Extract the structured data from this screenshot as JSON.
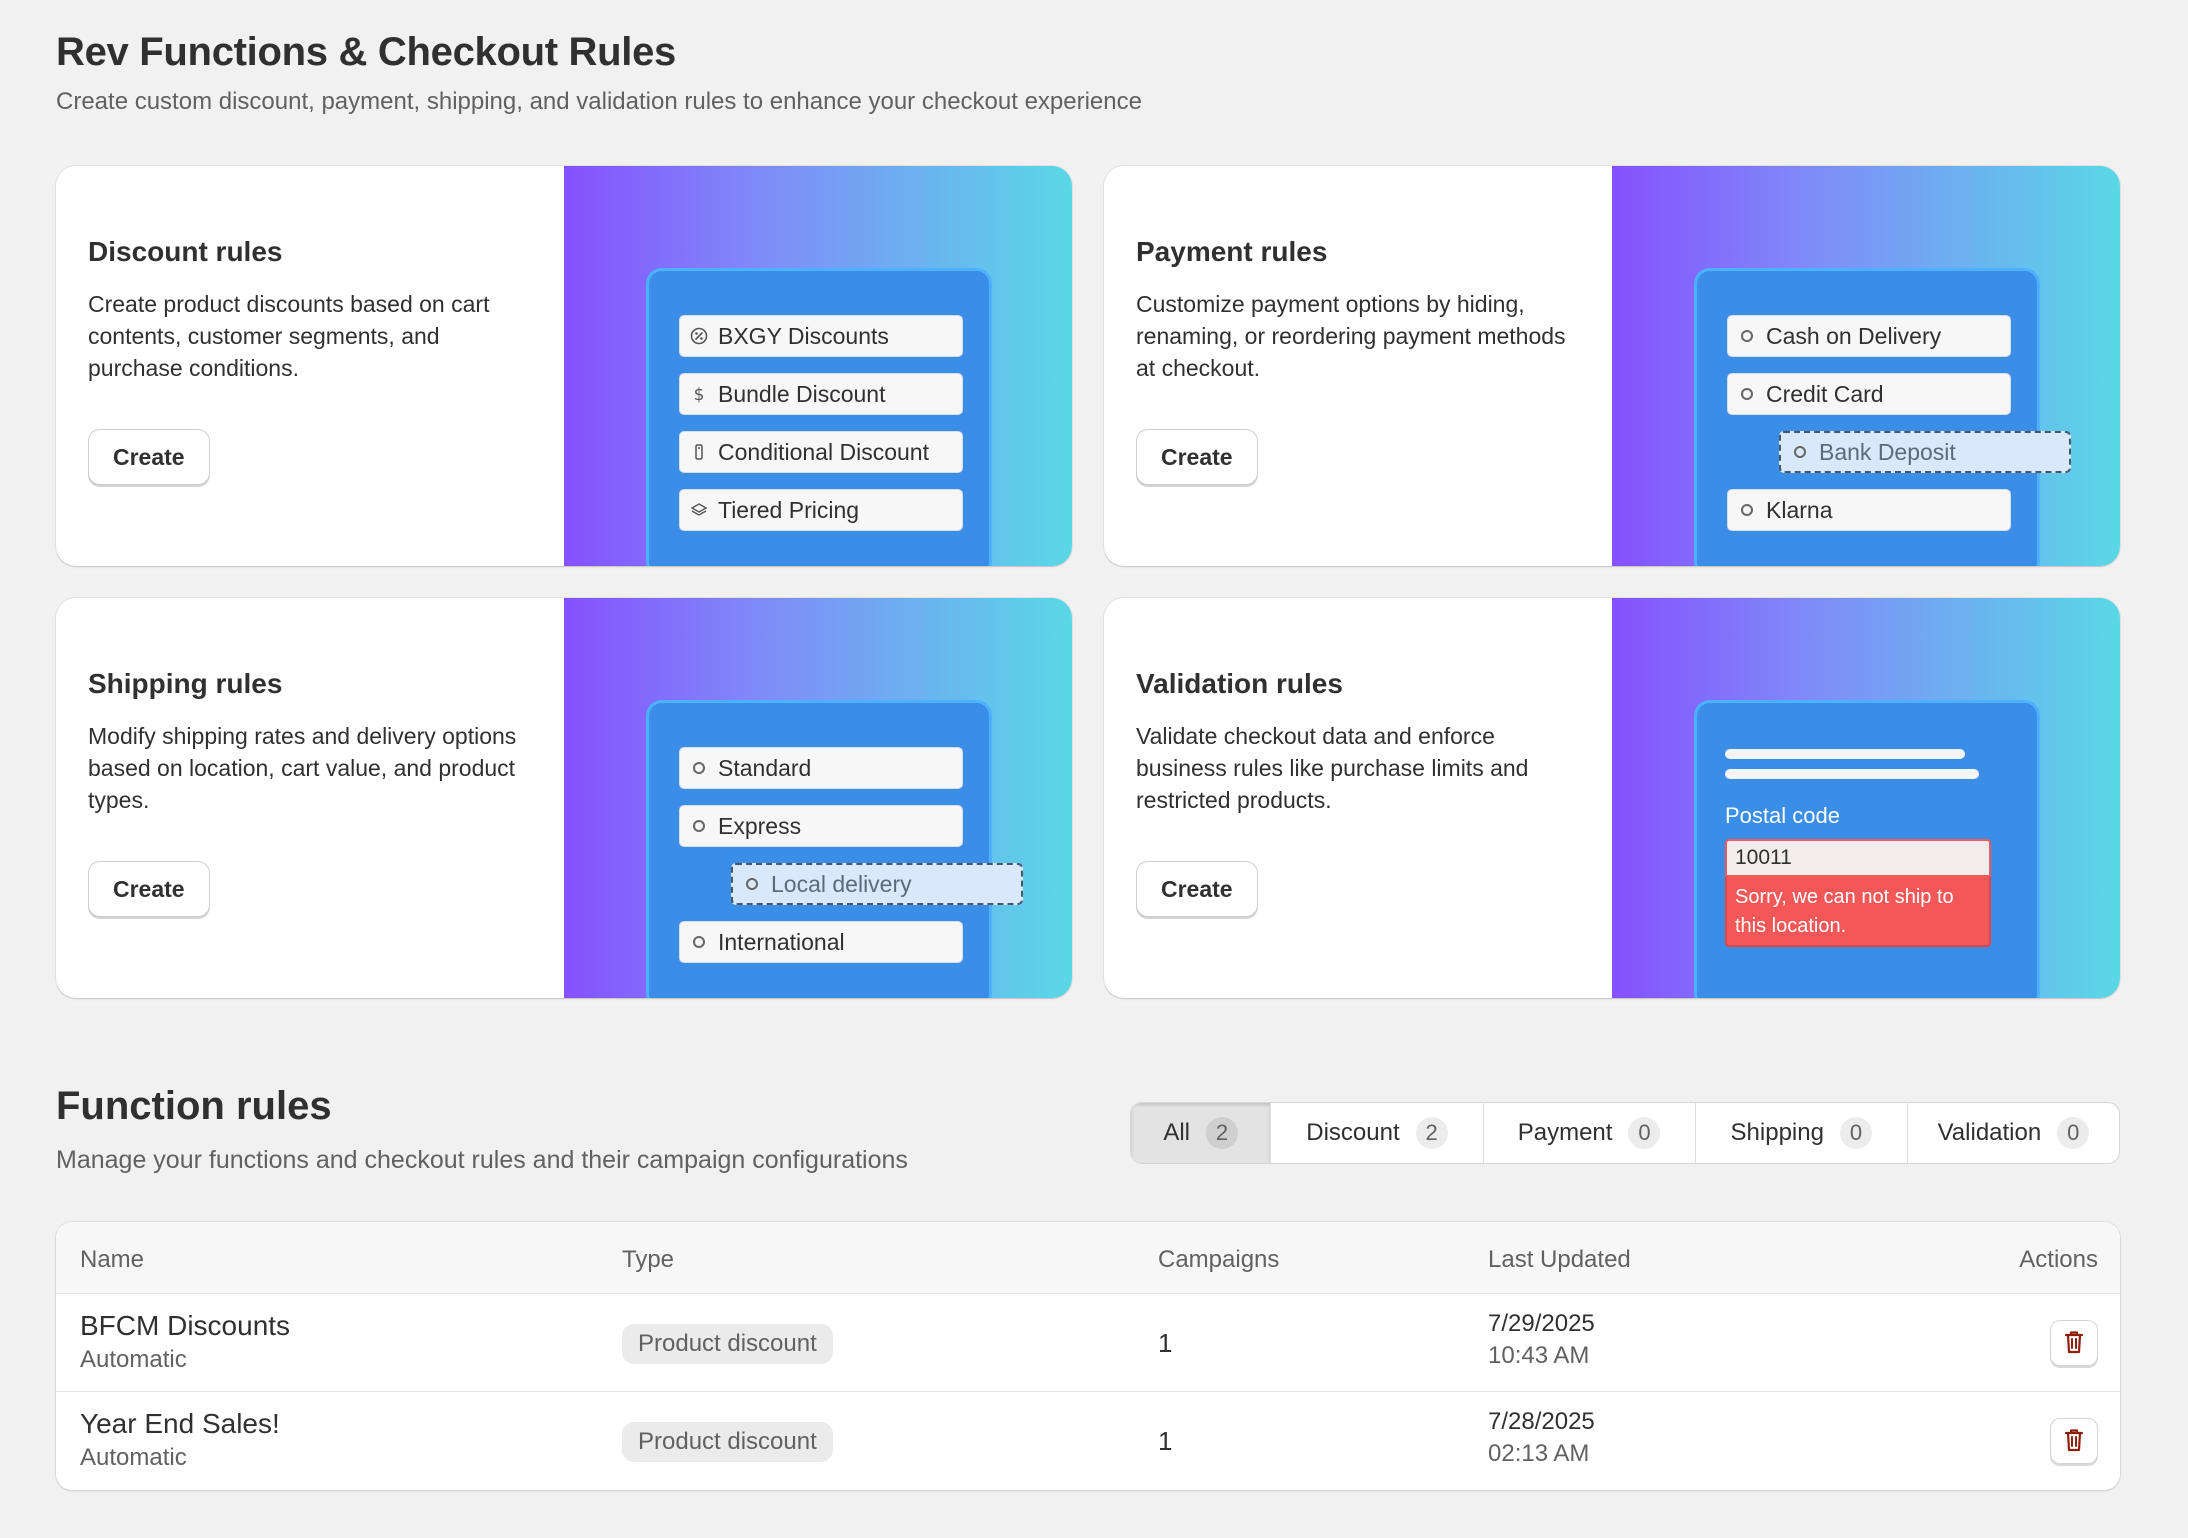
{
  "header": {
    "title": "Rev Functions & Checkout Rules",
    "subtitle": "Create custom discount, payment, shipping, and validation rules to enhance your checkout experience"
  },
  "cards": {
    "discount": {
      "title": "Discount rules",
      "description": "Create product discounts based on cart contents, customer segments, and purchase conditions.",
      "button": "Create",
      "items": [
        {
          "label": "BXGY Discounts",
          "icon": "percent-icon"
        },
        {
          "label": "Bundle Discount",
          "icon": "dollar-icon"
        },
        {
          "label": "Conditional Discount",
          "icon": "tag-icon"
        },
        {
          "label": "Tiered Pricing",
          "icon": "layers-icon"
        }
      ]
    },
    "payment": {
      "title": "Payment rules",
      "description": "Customize payment options by hiding, renaming, or reordering payment methods at checkout.",
      "button": "Create",
      "items": [
        "Cash on Delivery",
        "Credit Card",
        "Bank Deposit",
        "Klarna"
      ]
    },
    "shipping": {
      "title": "Shipping rules",
      "description": "Modify shipping rates and delivery options based on location, cart value, and product types.",
      "button": "Create",
      "items": [
        "Standard",
        "Express",
        "Local delivery",
        "International"
      ]
    },
    "validation": {
      "title": "Validation rules",
      "description": "Validate checkout data and enforce business rules like purchase limits and restricted products.",
      "button": "Create",
      "field_label": "Postal code",
      "field_value": "10011",
      "error_text": "Sorry, we can not ship to this location."
    }
  },
  "function_rules": {
    "title": "Function rules",
    "subtitle": "Manage your functions and checkout rules and their campaign configurations",
    "tabs": [
      {
        "label": "All",
        "count": "2",
        "active": true
      },
      {
        "label": "Discount",
        "count": "2"
      },
      {
        "label": "Payment",
        "count": "0"
      },
      {
        "label": "Shipping",
        "count": "0"
      },
      {
        "label": "Validation",
        "count": "0"
      }
    ],
    "columns": {
      "name": "Name",
      "type": "Type",
      "campaigns": "Campaigns",
      "updated": "Last Updated",
      "actions": "Actions"
    },
    "rows": [
      {
        "name": "BFCM Discounts",
        "mode": "Automatic",
        "type": "Product discount",
        "campaigns": "1",
        "date": "7/29/2025",
        "time": "10:43 AM"
      },
      {
        "name": "Year End Sales!",
        "mode": "Automatic",
        "type": "Product discount",
        "campaigns": "1",
        "date": "7/28/2025",
        "time": "02:13 AM"
      }
    ]
  },
  "colors": {
    "background": "#f1f1f1",
    "gradient_start": "#8551fd",
    "gradient_end": "#5ad8e6",
    "mock_panel": "#3a8ee8",
    "error": "#f45757",
    "delete_icon": "#8e1f0b"
  }
}
